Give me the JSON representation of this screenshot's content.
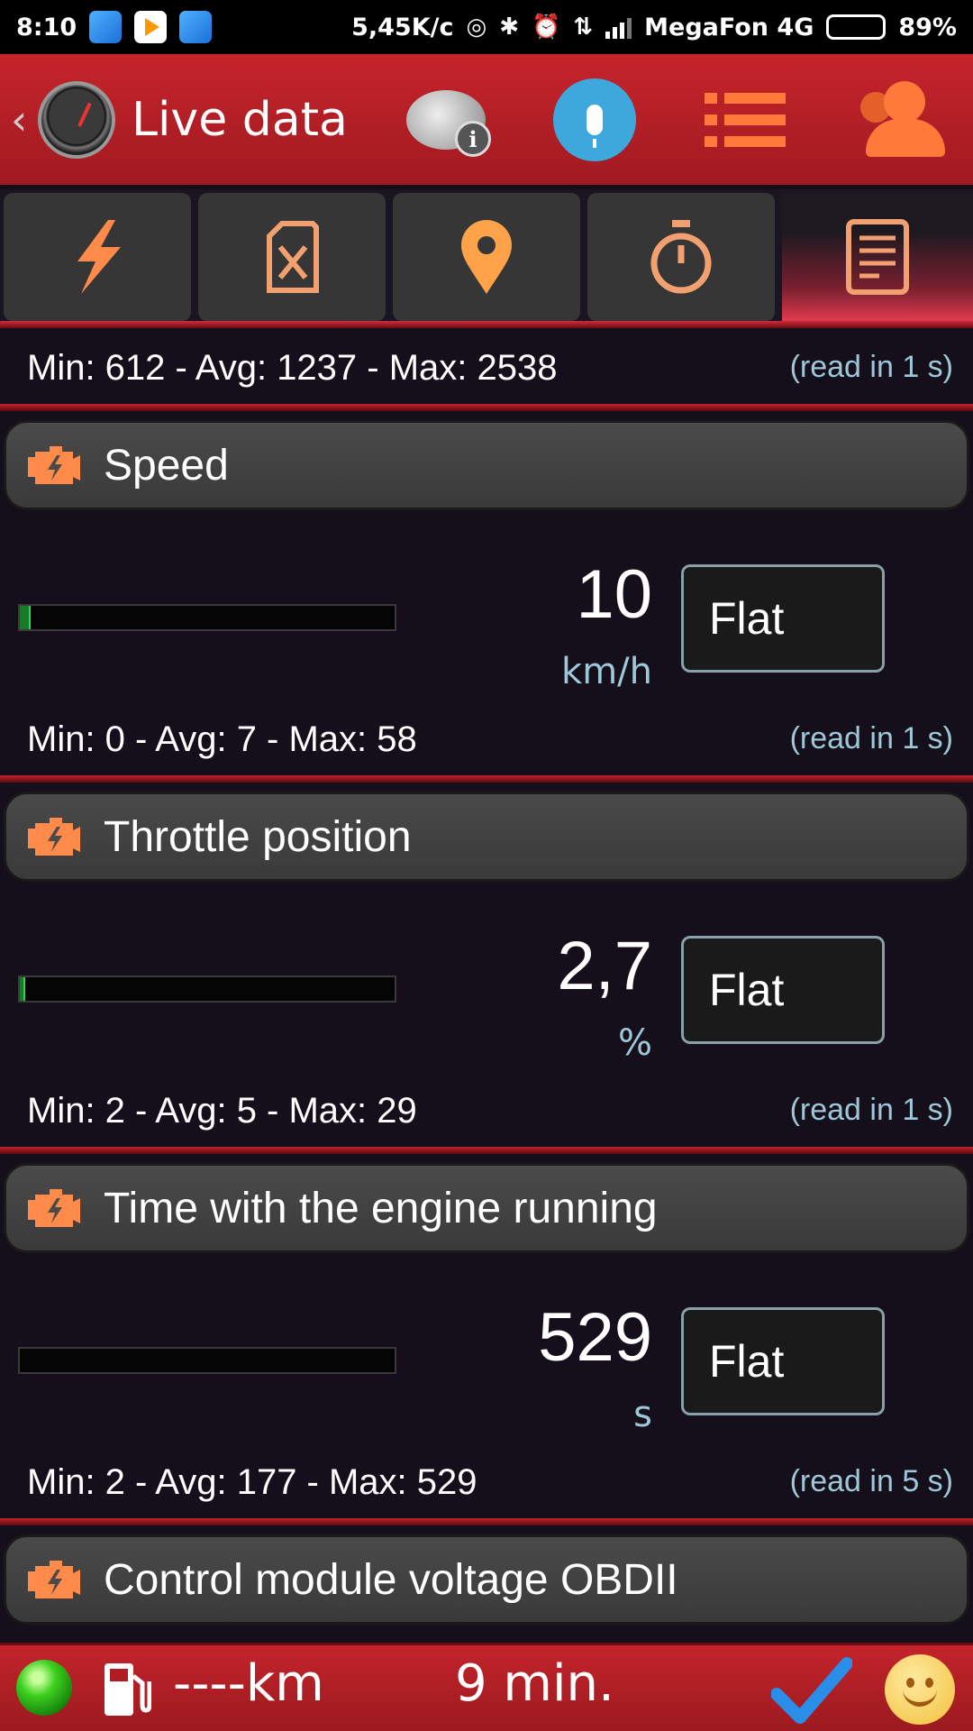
{
  "status_bar": {
    "time": "8:10",
    "net_speed": "5,45K/c",
    "carrier": "MegaFon 4G",
    "battery": "89%",
    "battery_level": 0.89
  },
  "header": {
    "back_icon": "chevron-left-icon",
    "title": "Live data",
    "buttons": [
      "info-chat-icon",
      "microphone-icon",
      "list-menu-icon",
      "users-icon"
    ]
  },
  "tabs": {
    "items": [
      "lightning-icon",
      "fuel-can-icon",
      "location-pin-icon",
      "stopwatch-icon",
      "document-icon"
    ],
    "active_index": 4
  },
  "top_stats": {
    "minmax": "Min: 612 - Avg: 1237 - Max: 2538",
    "read": "(read in 1 s)"
  },
  "sensors": [
    {
      "name": "Speed",
      "value": "10",
      "unit": "km/h",
      "button": "Flat",
      "bar_fraction": 0.03,
      "minmax": "Min: 0 - Avg: 7 - Max: 58",
      "read": "(read in 1 s)"
    },
    {
      "name": "Throttle position",
      "value": "2,7",
      "unit": "%",
      "button": "Flat",
      "bar_fraction": 0.015,
      "minmax": "Min: 2 - Avg: 5 - Max: 29",
      "read": "(read in 1 s)"
    },
    {
      "name": "Time with the engine running",
      "value": "529",
      "unit": "s",
      "button": "Flat",
      "bar_fraction": 0,
      "minmax": "Min: 2 - Avg: 177 - Max: 529",
      "read": "(read in 5 s)"
    },
    {
      "name": "Control module voltage OBDII"
    }
  ],
  "bottom_bar": {
    "distance": "----km",
    "duration": "9 min.",
    "colors": {
      "led": "#3fd01f",
      "check": "#2a8ee8",
      "smiley": "#f2c13a"
    }
  },
  "colors": {
    "accent": "#c6242b",
    "icon_orange": "#ff7a3a",
    "background": "#140f1a",
    "muted_blue": "#9ec8d8"
  }
}
